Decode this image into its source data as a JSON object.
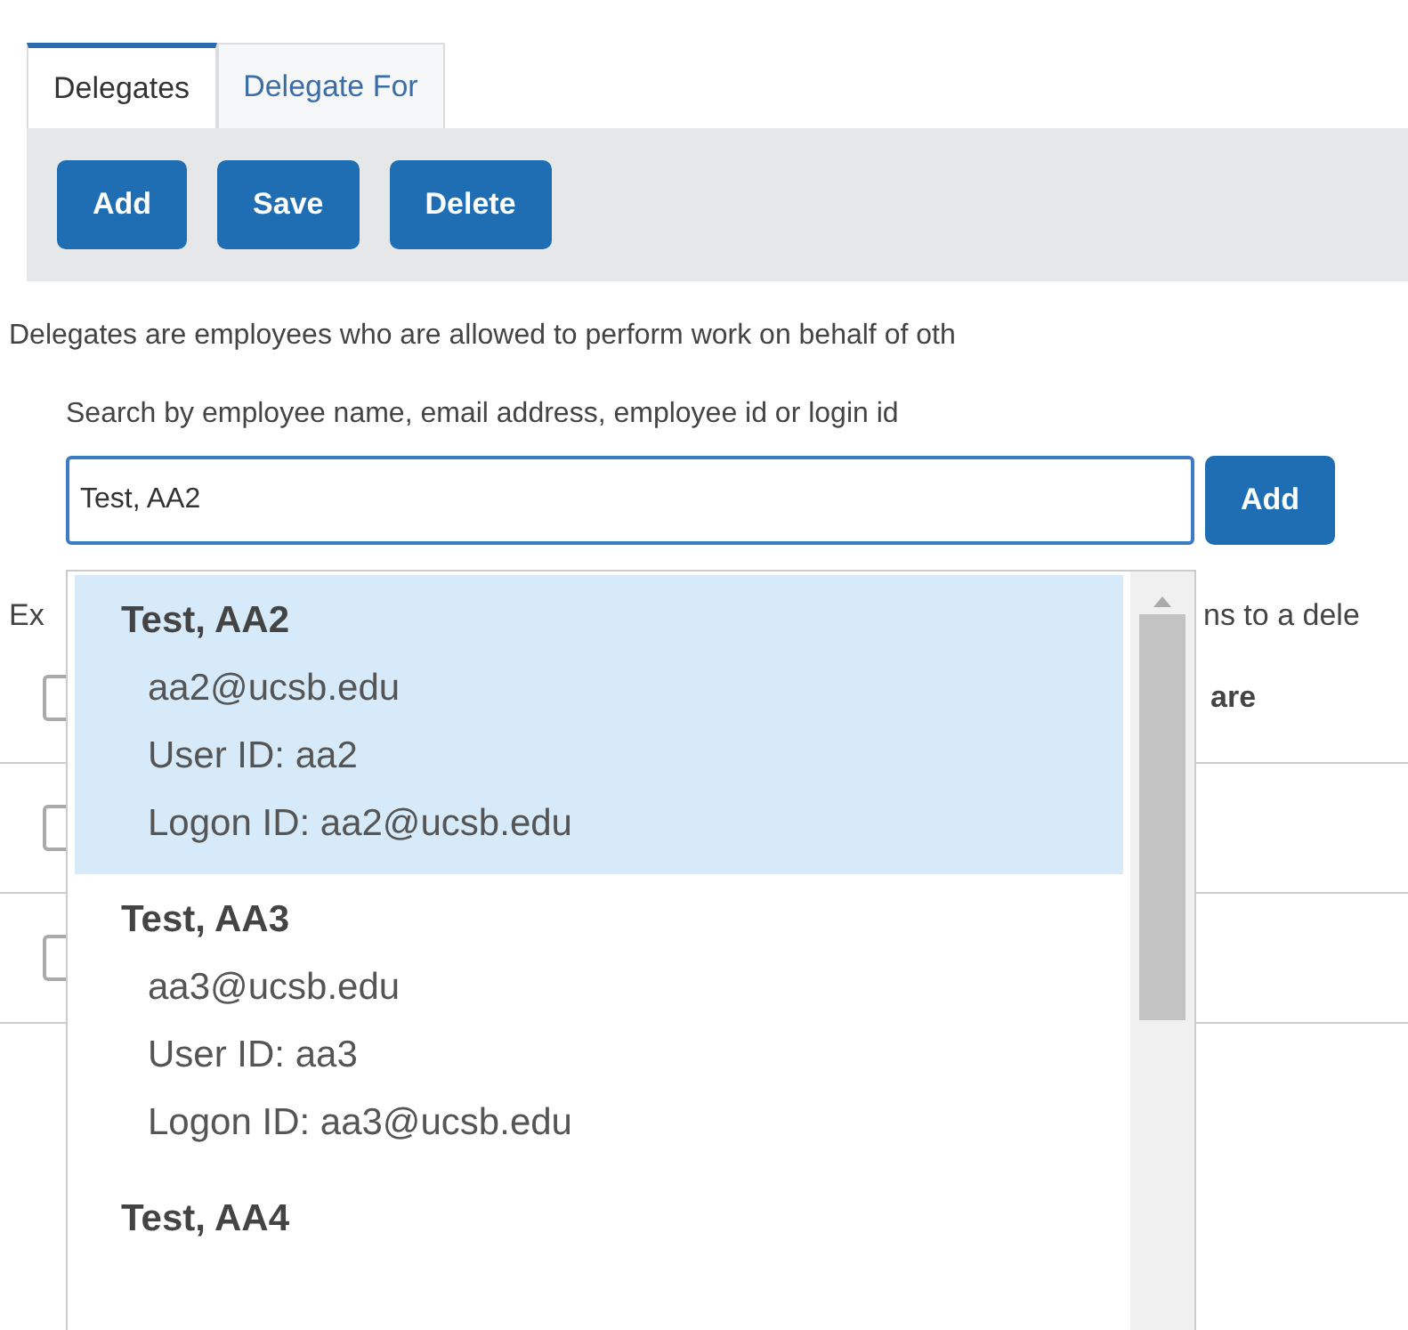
{
  "tabs": [
    {
      "label": "Delegates",
      "selected": true
    },
    {
      "label": "Delegate For",
      "selected": false
    }
  ],
  "toolbar": {
    "buttons": [
      "Add",
      "Save",
      "Delete"
    ]
  },
  "description": "Delegates are employees who are allowed to perform work on behalf of oth",
  "search": {
    "label": "Search by employee name, email address, employee id or login id",
    "value": "Test, AA2",
    "button": "Add"
  },
  "background": {
    "note_start": "Ex",
    "note_end": "ns to a dele",
    "header_checked": false,
    "header_column_end": "are",
    "rows": [
      {
        "checked": false
      },
      {
        "checked": false
      }
    ]
  },
  "suggestions": [
    {
      "name": "Test, AA2",
      "email": "aa2@ucsb.edu",
      "user_id": "User ID: aa2",
      "logon_id": "Logon ID: aa2@ucsb.edu",
      "selected": true
    },
    {
      "name": "Test, AA3",
      "email": "aa3@ucsb.edu",
      "user_id": "User ID: aa3",
      "logon_id": "Logon ID: aa3@ucsb.edu",
      "selected": false
    },
    {
      "name": "Test, AA4",
      "selected": false
    }
  ]
}
